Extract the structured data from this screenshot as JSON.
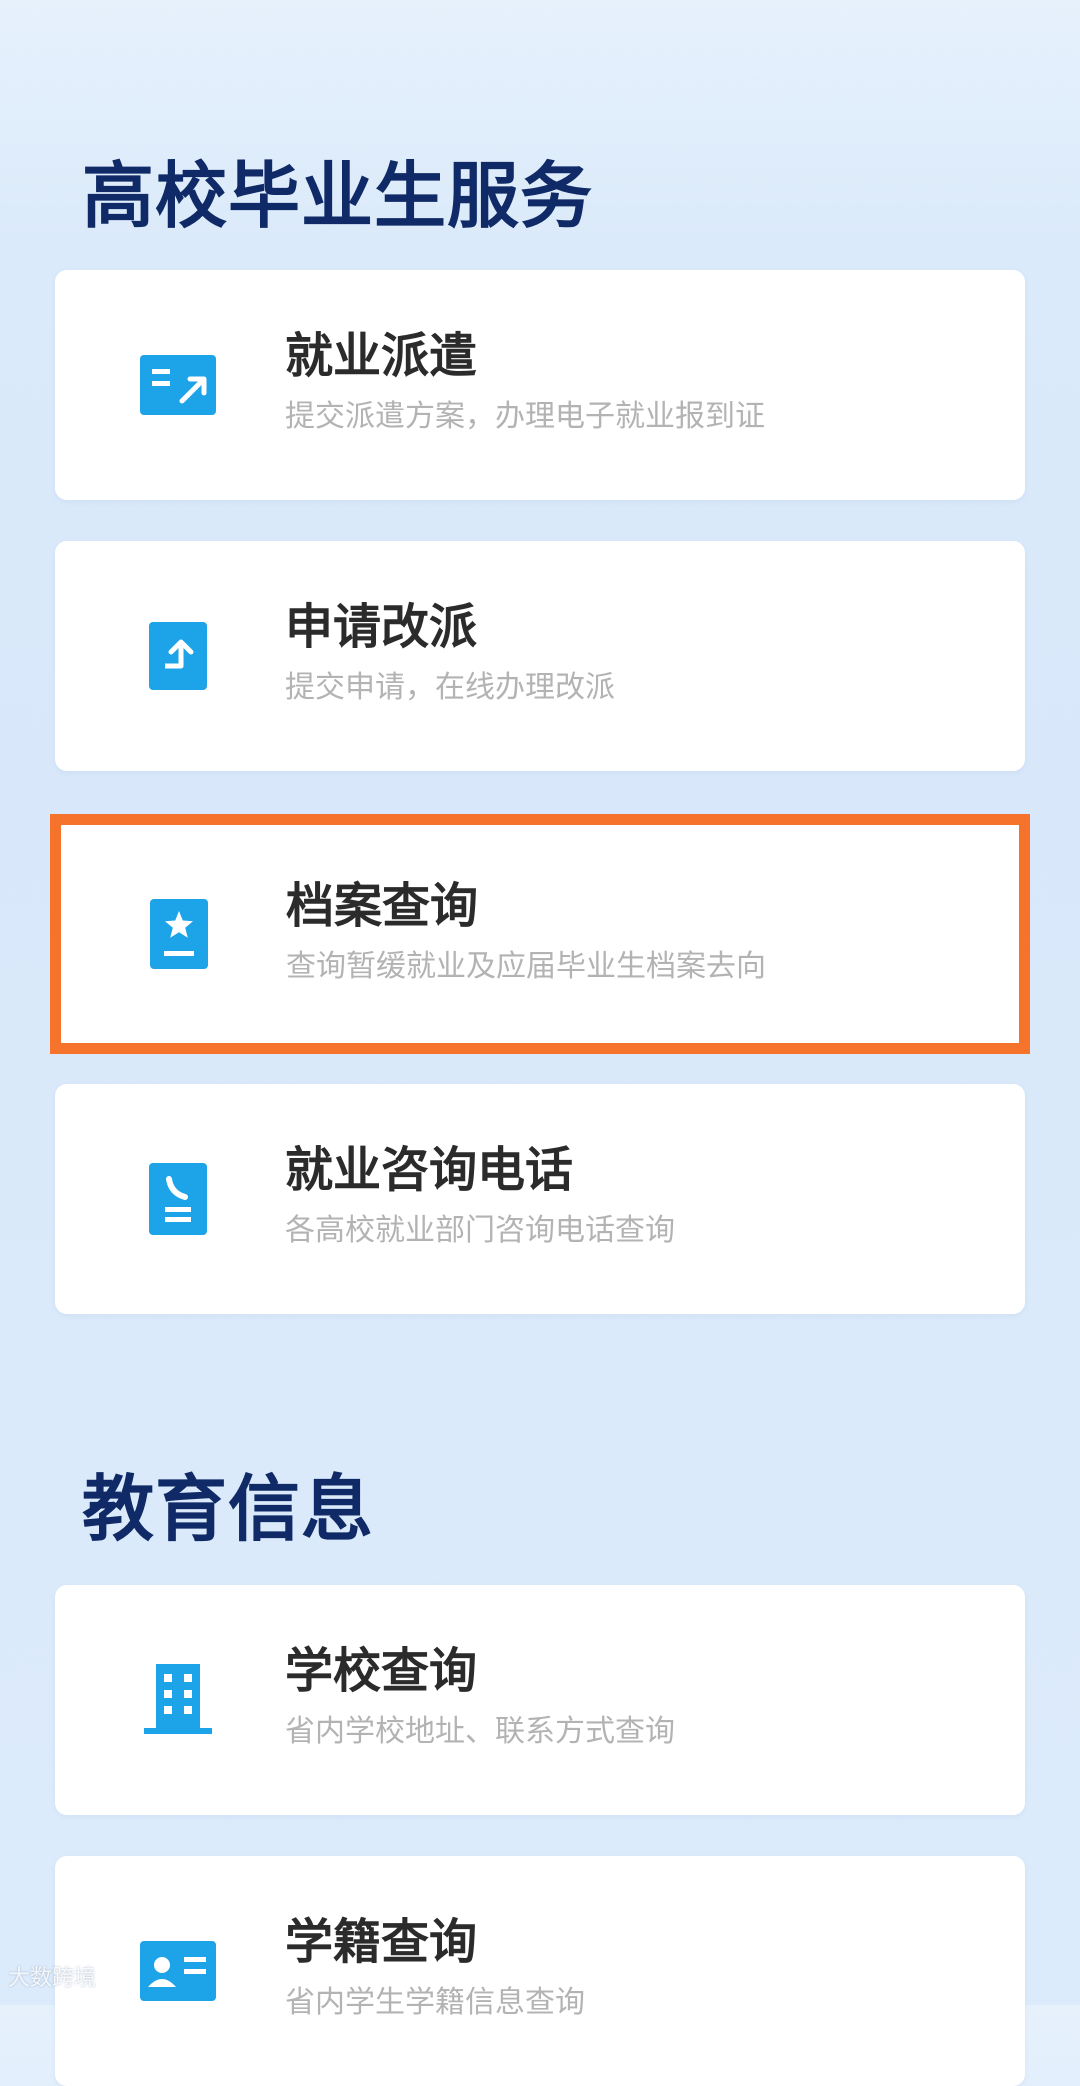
{
  "sections": [
    {
      "title": "高校毕业生服务",
      "items": [
        {
          "title": "就业派遣",
          "desc": "提交派遣方案，办理电子就业报到证",
          "icon": "dispatch-icon"
        },
        {
          "title": "申请改派",
          "desc": "提交申请，在线办理改派",
          "icon": "reassign-icon"
        },
        {
          "title": "档案查询",
          "desc": "查询暂缓就业及应届毕业生档案去向",
          "icon": "archive-star-icon",
          "highlighted": true
        },
        {
          "title": "就业咨询电话",
          "desc": "各高校就业部门咨询电话查询",
          "icon": "phone-list-icon"
        }
      ]
    },
    {
      "title": "教育信息",
      "items": [
        {
          "title": "学校查询",
          "desc": "省内学校地址、联系方式查询",
          "icon": "school-building-icon"
        },
        {
          "title": "学籍查询",
          "desc": "省内学生学籍信息查询",
          "icon": "student-card-icon"
        }
      ]
    }
  ],
  "watermark": "大数跨境",
  "colors": {
    "accent": "#1ca3e8",
    "highlight": "#f5732a",
    "title": "#0f2a66"
  }
}
